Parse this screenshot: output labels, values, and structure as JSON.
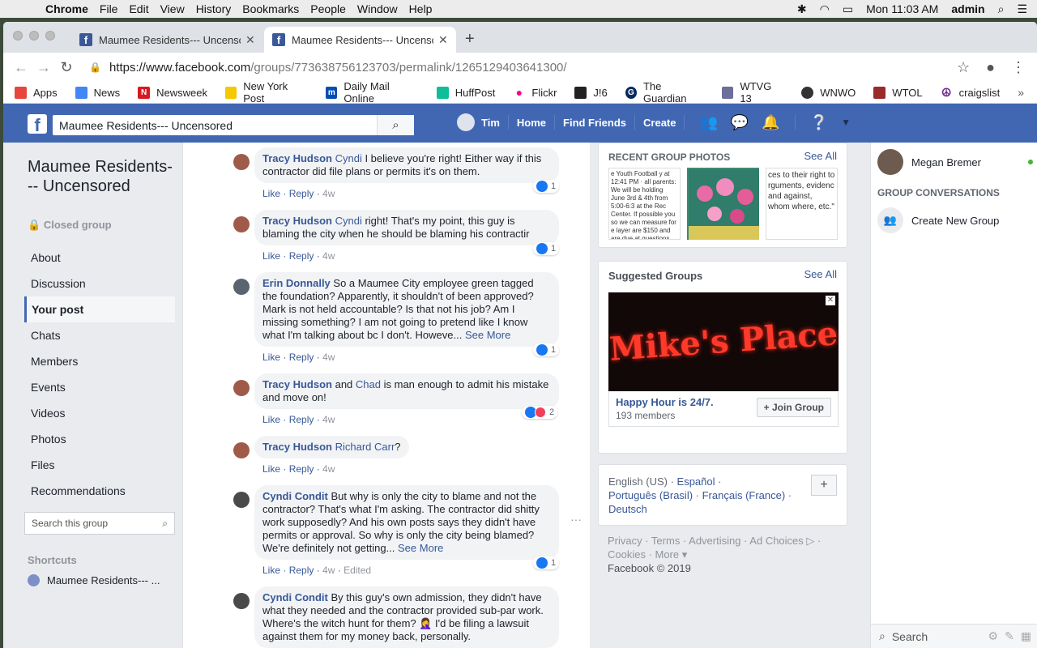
{
  "menubar": {
    "app": "Chrome",
    "items": [
      "File",
      "Edit",
      "View",
      "History",
      "Bookmarks",
      "People",
      "Window",
      "Help"
    ],
    "clock": "Mon 11:03 AM",
    "user": "admin"
  },
  "tabs": [
    {
      "title": "Maumee Residents--- Uncenso"
    },
    {
      "title": "Maumee Residents--- Uncenso"
    }
  ],
  "url": {
    "host": "https://www.facebook.com",
    "path": "/groups/773638756123703/permalink/1265129403641300/"
  },
  "bookmarks": [
    "Apps",
    "News",
    "Newsweek",
    "New York Post",
    "Daily Mail Online",
    "HuffPost",
    "Flickr",
    "J!6",
    "The Guardian",
    "WTVG 13",
    "WNWO",
    "WTOL",
    "craigslist"
  ],
  "fb": {
    "search_value": "Maumee Residents--- Uncensored",
    "user": "Tim",
    "nav": [
      "Home",
      "Find Friends",
      "Create"
    ]
  },
  "group": {
    "name": "Maumee Residents--- Uncensored",
    "privacy": "Closed group",
    "nav": [
      "About",
      "Discussion",
      "Your post",
      "Chats",
      "Members",
      "Events",
      "Videos",
      "Photos",
      "Files",
      "Recommendations"
    ],
    "search_placeholder": "Search this group",
    "shortcuts_title": "Shortcuts",
    "shortcut": "Maumee Residents--- ..."
  },
  "comments": [
    {
      "name": "Tracy Hudson",
      "tag": "Cyndi",
      "text": " I believe you're right! Either way if this contractor did file plans or permits it's on them.",
      "more": "",
      "time": "4w",
      "reacts": "1",
      "edited": ""
    },
    {
      "name": "Tracy Hudson",
      "tag": "Cyndi",
      "text": " right! That's my point, this guy is blaming the city when he should be blaming his contractir",
      "more": "",
      "time": "4w",
      "reacts": "1",
      "edited": ""
    },
    {
      "name": "Erin Donnally",
      "tag": "",
      "text": " So a Maumee City employee green tagged the foundation? Apparently, it shouldn't of been approved? Mark is not held accountable? Is that not his job? Am I missing something? I am not going to pretend like I know what I'm talking about bc I don't. Howeve...",
      "more": "See More",
      "time": "4w",
      "reacts": "1",
      "edited": ""
    },
    {
      "name": "Tracy Hudson",
      "tag": "Chad",
      "text": " is man enough to admit his mistake and move on!",
      "more": "",
      "time": "4w",
      "reacts": "2",
      "edited": ""
    },
    {
      "name": "Tracy Hudson",
      "tag": "Richard Carr",
      "text": "?",
      "more": "",
      "time": "4w",
      "reacts": "",
      "edited": ""
    },
    {
      "name": "Cyndi Condit",
      "tag": "",
      "text": " But why is only the city to blame and not the contractor? That's what I'm asking. The contractor did shitty work supposedly? And his own posts says they didn't have permits or approval. So why is only the city being blamed? We're definitely not getting...",
      "more": "See More",
      "time": "4w",
      "reacts": "1",
      "edited": "Edited"
    },
    {
      "name": "Cyndi Condit",
      "tag": "",
      "text": " By this guy's own admission, they didn't have what they needed and the contractor provided sub-par work. Where's the witch hunt for them? 🤦‍♀️ I'd be filing a lawsuit against them for my money back, personally.",
      "more": "",
      "time": "",
      "reacts": "",
      "edited": ""
    }
  ],
  "labels": {
    "like": "Like",
    "reply": "Reply",
    "and": "and"
  },
  "right": {
    "photos_title": "RECENT GROUP PHOTOS",
    "see_all": "See All",
    "photo1_text": "e Youth Football y at 12:41 PM · all parents: We will be holding June 3rd & 4th from 5:00-6:3 at the Rec Center. If possible you so we can measure for e layer are $150 and are due at questions please feel free to s",
    "photo3_text": "ces to their right to rguments, evidenc and against, whom where, etc.\"",
    "suggested_title": "Suggested Groups",
    "sg_image_text": "Mike's Place",
    "sg_group": "Happy Hour is 24/7.",
    "sg_members": "193 members",
    "join": "Join Group",
    "lang_current": "English (US)",
    "langs": [
      "Español",
      "Português (Brasil)",
      "Français (France)",
      "Deutsch"
    ],
    "footer_links": "Privacy · Terms · Advertising · Ad Choices ▷ · Cookies · More ▾",
    "copyright": "Facebook © 2019"
  },
  "chat": {
    "contact": "Megan Bremer",
    "conv_title": "GROUP CONVERSATIONS",
    "create": "Create New Group",
    "search": "Search"
  }
}
